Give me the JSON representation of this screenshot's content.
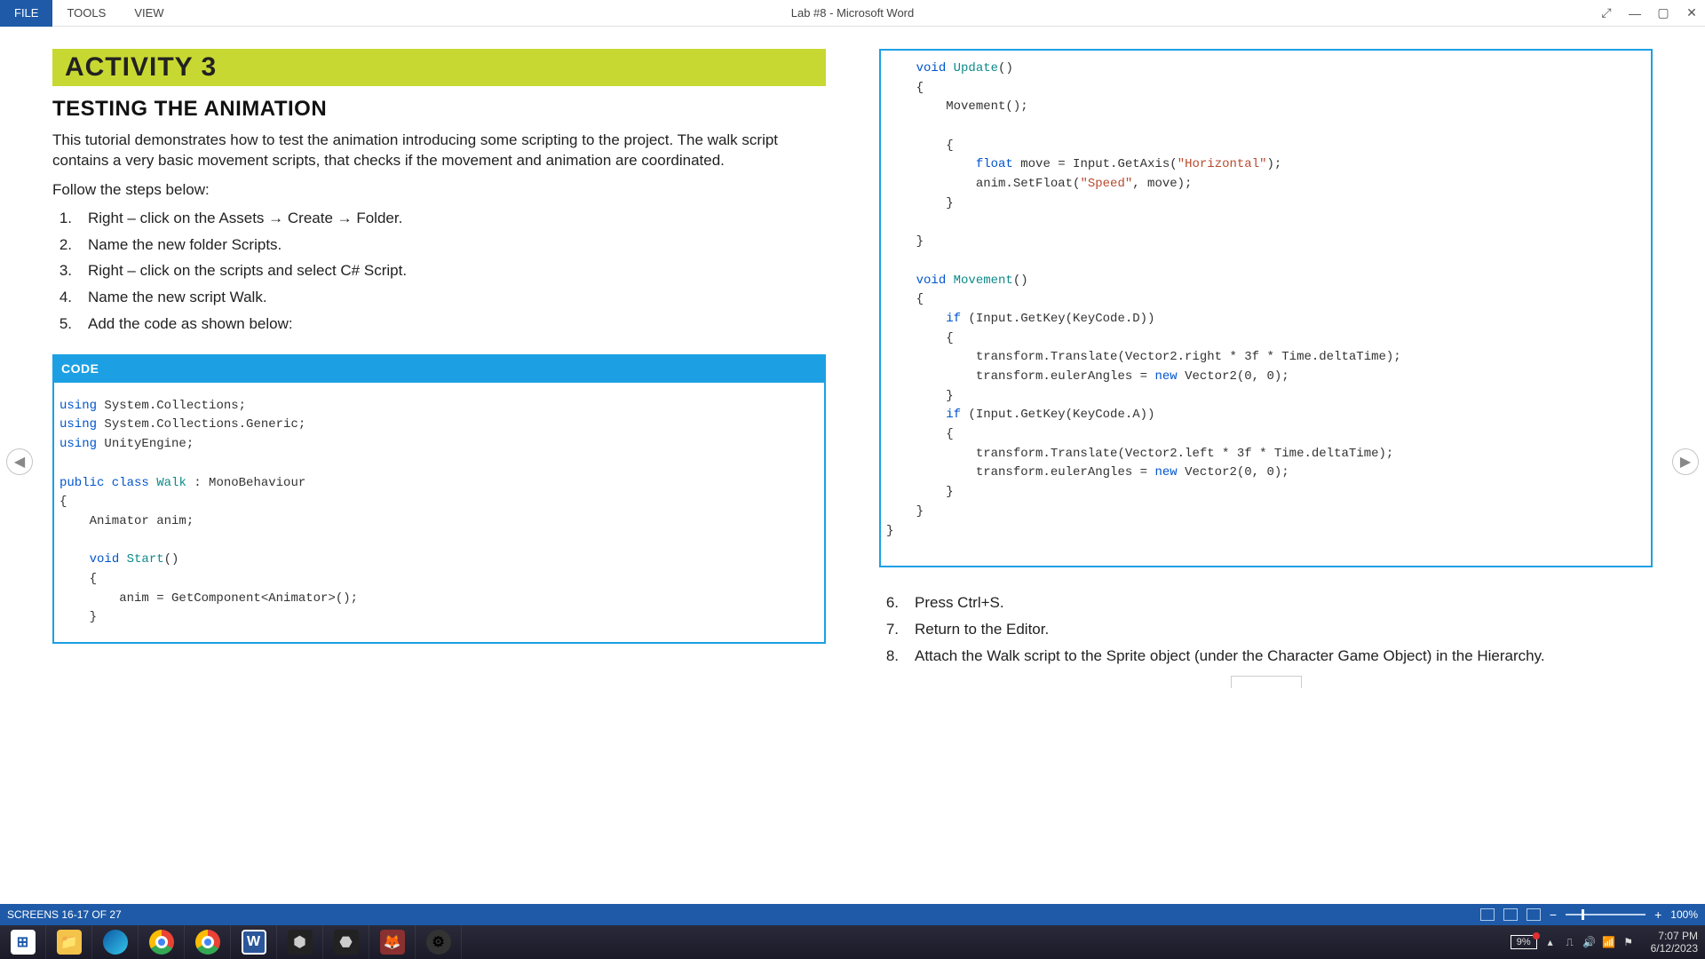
{
  "menubar": {
    "file": "FILE",
    "tools": "TOOLS",
    "view": "VIEW",
    "title": "Lab #8 - Microsoft Word"
  },
  "nav": {
    "prev": "◀",
    "next": "▶"
  },
  "leftPage": {
    "activity": "ACTIVITY 3",
    "sectionTitle": "TESTING THE ANIMATION",
    "intro": "This tutorial demonstrates how to test the animation introducing some scripting to the project. The walk script contains a very basic movement scripts, that checks if the movement and animation are coordinated.",
    "follow": "Follow the steps below:",
    "steps": [
      {
        "n": "1.",
        "t": "Right – click on the Assets → Create → Folder."
      },
      {
        "n": "2.",
        "t": "Name the new folder Scripts."
      },
      {
        "n": "3.",
        "t": "Right – click on the scripts and select C# Script."
      },
      {
        "n": "4.",
        "t": "Name the new script Walk."
      },
      {
        "n": "5.",
        "t": "Add the code as shown below:"
      }
    ],
    "codeHeader": "CODE"
  },
  "rightPage": {
    "steps": [
      {
        "n": "6.",
        "t": "Press Ctrl+S."
      },
      {
        "n": "7.",
        "t": "Return to the Editor."
      },
      {
        "n": "8.",
        "t": "Attach the Walk script to the Sprite object (under the Character Game Object) in the Hierarchy."
      }
    ]
  },
  "statusbar": {
    "left": "SCREENS 16-17 OF 27",
    "zoom": "100%"
  },
  "taskbar": {
    "battery": "9%",
    "time": "7:07 PM",
    "date": "6/12/2023"
  }
}
